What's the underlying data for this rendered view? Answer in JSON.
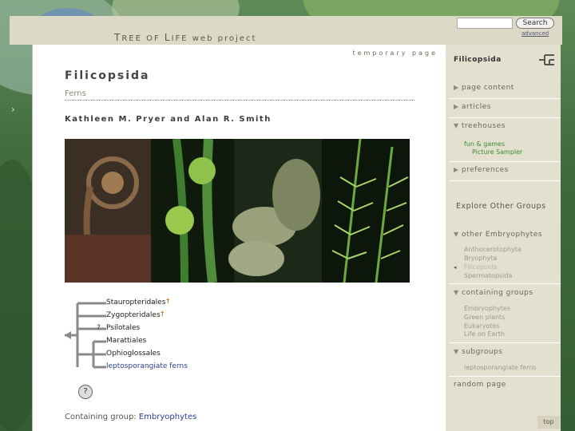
{
  "header": {
    "site_title_parts": [
      "T",
      "REE OF ",
      "L",
      "IFE web project"
    ],
    "search_label": "Search",
    "advanced_label": "advanced"
  },
  "main": {
    "temporary_label": "temporary page",
    "title": "Filicopsida",
    "subtitle": "Ferns",
    "authors": "Kathleen M. Pryer and Alan R. Smith",
    "containing_label": "Containing group:",
    "containing_link": "Embryophytes"
  },
  "tree": {
    "taxa": [
      {
        "name": "Stauropteridales",
        "mark": "†",
        "mark_color": "#b35a00",
        "prefix": ""
      },
      {
        "name": "Zygopteridales",
        "mark": "†",
        "mark_color": "#b35a00",
        "prefix": ""
      },
      {
        "name": "Psilotales",
        "mark": "",
        "mark_color": "",
        "prefix": "?"
      },
      {
        "name": "Marattiales",
        "mark": "",
        "mark_color": "",
        "prefix": ""
      },
      {
        "name": "Ophioglossales",
        "mark": "",
        "mark_color": "",
        "prefix": ""
      },
      {
        "name": "leptosporangiate ferns",
        "mark": "",
        "mark_color": "",
        "prefix": ""
      }
    ],
    "help_label": "?"
  },
  "sidebar": {
    "title": "Filicopsida",
    "items": [
      {
        "label": "page content",
        "expanded": false
      },
      {
        "label": "articles",
        "expanded": false
      },
      {
        "label": "treehouses",
        "expanded": true
      }
    ],
    "treehouses_sub": [
      "fun & games",
      "Picture Sampler"
    ],
    "preferences_label": "preferences",
    "explore_label": "Explore Other Groups",
    "other_label": "other Embryophytes",
    "other_items": [
      "Anthocerotophyta",
      "Bryophyta",
      "Filicopsida",
      "Spermatopsida"
    ],
    "containing_label": "containing groups",
    "containing_items": [
      "Embryophytes",
      "Green plants",
      "Eukaryotes",
      "Life on Earth"
    ],
    "subgroups_label": "subgroups",
    "subgroups_items": [
      "leptosporangiate ferns"
    ],
    "random_label": "random page",
    "top_label": "top"
  },
  "colors": {
    "link": "#2a3f8f",
    "fun_games": "#3b8a2e",
    "extinct_mark": "#b35a00"
  }
}
